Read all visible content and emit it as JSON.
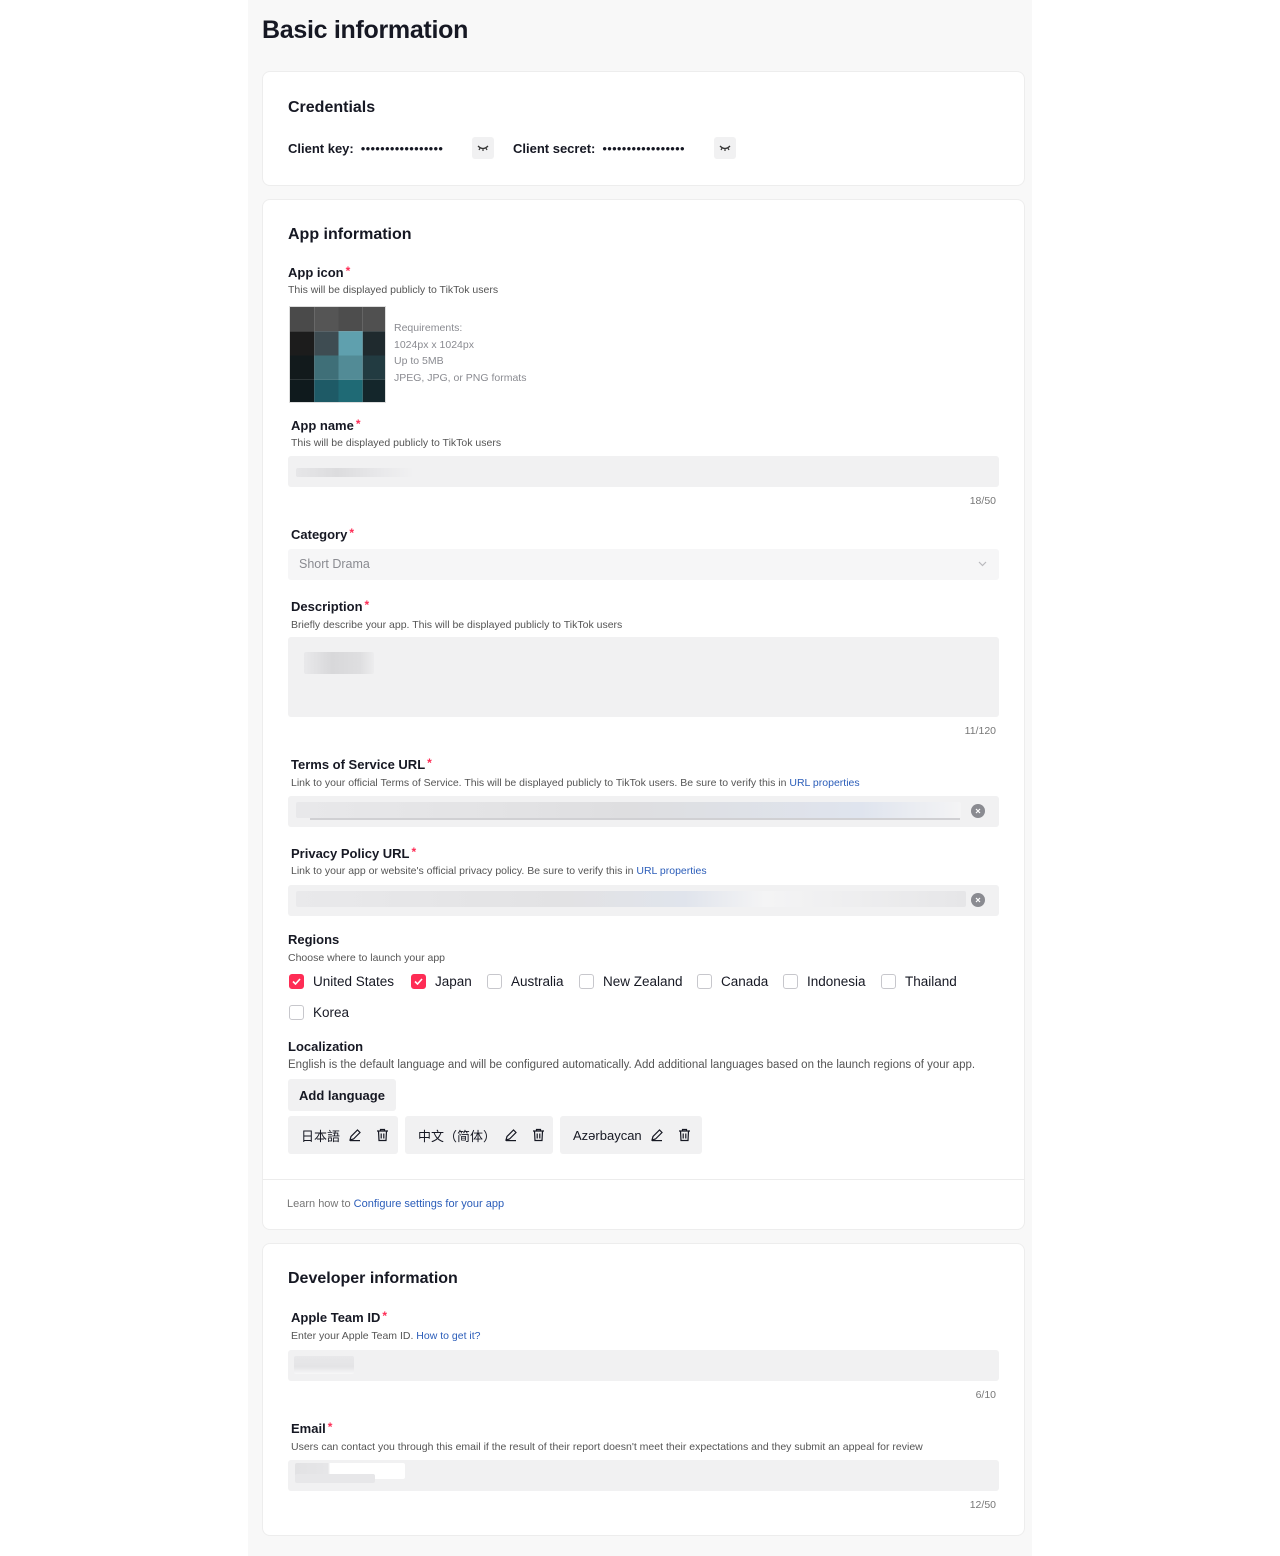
{
  "page": {
    "title": "Basic information"
  },
  "credentials": {
    "title": "Credentials",
    "client_key_label": "Client key:",
    "client_key_masked": "•••••••••••••••••",
    "client_secret_label": "Client secret:",
    "client_secret_masked": "•••••••••••••••••"
  },
  "app_info": {
    "title": "App information",
    "app_icon": {
      "label": "App icon",
      "hint": "This will be displayed publicly to TikTok users",
      "requirements": [
        "Requirements:",
        "1024px x 1024px",
        "Up to 5MB",
        "JPEG, JPG, or PNG formats"
      ]
    },
    "app_name": {
      "label": "App name",
      "hint": "This will be displayed publicly to TikTok users",
      "counter": "18/50"
    },
    "category": {
      "label": "Category",
      "value": "Short Drama"
    },
    "description": {
      "label": "Description",
      "hint": "Briefly describe your app. This will be displayed publicly to TikTok users",
      "counter": "11/120"
    },
    "terms_url": {
      "label": "Terms of Service URL",
      "hint": "Link to your official Terms of Service. This will be displayed publicly to TikTok users. Be sure to verify this in",
      "link": "URL properties"
    },
    "privacy_url": {
      "label": "Privacy Policy URL",
      "hint": "Link to your app or website's official privacy policy. Be sure to verify this in",
      "link": "URL properties"
    },
    "regions": {
      "label": "Regions",
      "hint": "Choose where to launch your app",
      "items": [
        {
          "name": "United States",
          "checked": true
        },
        {
          "name": "Japan",
          "checked": true
        },
        {
          "name": "Australia",
          "checked": false
        },
        {
          "name": "New Zealand",
          "checked": false
        },
        {
          "name": "Canada",
          "checked": false
        },
        {
          "name": "Indonesia",
          "checked": false
        },
        {
          "name": "Thailand",
          "checked": false
        },
        {
          "name": "Korea",
          "checked": false
        }
      ]
    },
    "localization": {
      "label": "Localization",
      "hint": "English is the default language and will be configured automatically. Add additional languages based on the launch regions of your app.",
      "add_button": "Add language",
      "languages": [
        "日本語",
        "中文（简体）",
        "Azərbaycan"
      ]
    },
    "footer": {
      "prefix": "Learn how to",
      "link": "Configure settings for your app"
    }
  },
  "developer_info": {
    "title": "Developer information",
    "apple_team_id": {
      "label": "Apple Team ID",
      "hint": "Enter your Apple Team ID.",
      "link": "How to get it?",
      "counter": "6/10"
    },
    "email": {
      "label": "Email",
      "hint": "Users can contact you through this email if the result of their report doesn't meet their expectations and they submit an appeal for review",
      "counter": "12/50"
    }
  },
  "colors": {
    "accent": "#fe2c55",
    "link": "#2b5db9",
    "input_bg": "#f1f1f2",
    "page_bg": "#f8f8f8"
  }
}
